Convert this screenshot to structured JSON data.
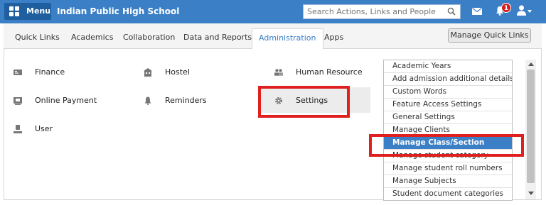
{
  "topbar": {
    "menu_label": "Menu",
    "school_name": "Indian Public High School",
    "search_placeholder": "Search Actions, Links and People",
    "notification_count": "1",
    "colors": {
      "bar": "#3b7fc6",
      "menu_button": "#1f5f9f",
      "badge": "#d81b1b"
    },
    "icons": [
      "menu-grid-icon",
      "search-icon",
      "mail-icon",
      "bell-icon",
      "user-icon",
      "caret-down-icon"
    ]
  },
  "tabs": [
    {
      "label": "Quick Links"
    },
    {
      "label": "Academics"
    },
    {
      "label": "Collaboration"
    },
    {
      "label": "Data and Reports"
    },
    {
      "label": "Administration",
      "active": true
    },
    {
      "label": "Apps"
    }
  ],
  "manage_quick_links_label": "Manage Quick Links",
  "admin_items": [
    {
      "label": "Finance",
      "icon": "finance-icon"
    },
    {
      "label": "Online Payment",
      "icon": "payment-icon"
    },
    {
      "label": "User",
      "icon": "user-icon"
    },
    {
      "label": "Hostel",
      "icon": "hostel-icon"
    },
    {
      "label": "Reminders",
      "icon": "bell-icon"
    },
    {
      "label": "Human Resource",
      "icon": "people-icon"
    },
    {
      "label": "Settings",
      "icon": "gear-icon",
      "highlighted": true
    }
  ],
  "settings_submenu": [
    {
      "label": "Academic Years"
    },
    {
      "label": "Add admission additional details"
    },
    {
      "label": "Custom Words"
    },
    {
      "label": "Feature Access Settings"
    },
    {
      "label": "General Settings"
    },
    {
      "label": "Manage Clients"
    },
    {
      "label": "Manage Class/Section",
      "active": true
    },
    {
      "label": "Manage student category"
    },
    {
      "label": "Manage student roll numbers"
    },
    {
      "label": "Manage Subjects"
    },
    {
      "label": "Student document categories"
    }
  ],
  "highlight_color": "#e0201f"
}
